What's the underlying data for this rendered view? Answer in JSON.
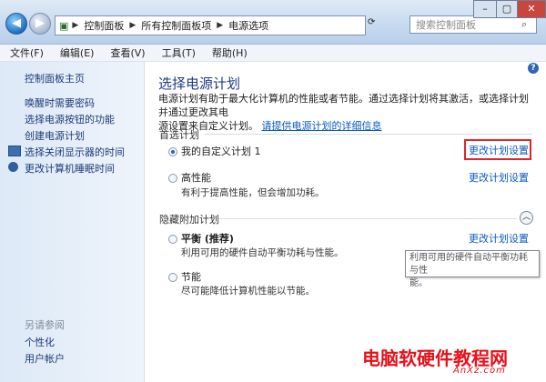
{
  "address": {
    "crumbs": [
      "控制面板",
      "所有控制面板项",
      "电源选项"
    ],
    "search_placeholder": "搜索控制面板"
  },
  "window_controls": {
    "minimize": "–",
    "maximize": "▢",
    "close": "✕"
  },
  "menu": [
    "文件(F)",
    "编辑(E)",
    "查看(V)",
    "工具(T)",
    "帮助(H)"
  ],
  "sidebar": {
    "home": "控制面板主页",
    "links": [
      "唤醒时需要密码",
      "选择电源按钮的功能",
      "创建电源计划",
      "选择关闭显示器的时间",
      "更改计算机睡眠时间"
    ],
    "see_also": "另请参阅",
    "see_also_links": [
      "个性化",
      "用户帐户"
    ]
  },
  "main": {
    "title": "选择电源计划",
    "desc_line1": "电源计划有助于最大化计算机的性能或者节能。通过选择计划将其激活，或选择计划并通过更改其电",
    "desc_line2": "源设置来自定义计划。",
    "more_info_link": "请提供电源计划的详细信息",
    "preferred_group": "首选计划",
    "hidden_group": "隐藏附加计划",
    "plans": [
      {
        "name": "我的自定义计划 1",
        "desc": "",
        "selected": true,
        "change_link": "更改计划设置"
      },
      {
        "name": "高性能",
        "desc": "有利于提高性能，但会增加功耗。",
        "selected": false,
        "change_link": "更改计划设置"
      },
      {
        "name": "平衡 (推荐)",
        "desc": "利用可用的硬件自动平衡功耗与性能。",
        "selected": false,
        "change_link": "更改计划设置"
      },
      {
        "name": "节能",
        "desc": "尽可能降低计算机性能以节能。",
        "selected": false,
        "change_link": ""
      }
    ],
    "tooltip_line1": "利用可用的硬件自动平衡功耗与性",
    "tooltip_line2": "能。"
  },
  "watermark": {
    "main": "电脑软硬件教程网",
    "sub": "AnXz.com"
  }
}
